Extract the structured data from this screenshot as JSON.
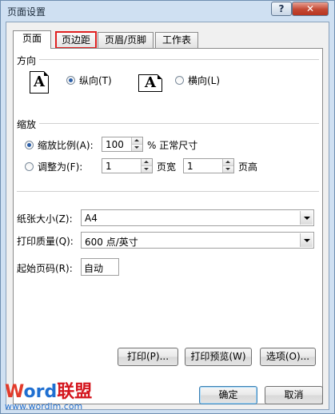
{
  "window": {
    "title": "页面设置",
    "help_label": "?",
    "close_label": "✕"
  },
  "tabs": [
    {
      "label": "页面",
      "active": true
    },
    {
      "label": "页边距",
      "active": false,
      "highlighted": true
    },
    {
      "label": "页眉/页脚",
      "active": false
    },
    {
      "label": "工作表",
      "active": false
    }
  ],
  "orientation": {
    "section_label": "方向",
    "portrait_label": "纵向(T)",
    "portrait_icon_text": "A",
    "landscape_label": "横向(L)",
    "landscape_icon_text": "A",
    "selected": "portrait"
  },
  "scaling": {
    "section_label": "缩放",
    "adjust_label": "缩放比例(A):",
    "adjust_value": "100",
    "adjust_suffix": "% 正常尺寸",
    "fit_label": "调整为(F):",
    "fit_wide_value": "1",
    "fit_wide_suffix": "页宽",
    "fit_tall_value": "1",
    "fit_tall_suffix": "页高",
    "selected": "adjust"
  },
  "paper_size": {
    "label": "纸张大小(Z):",
    "value": "A4"
  },
  "print_quality": {
    "label": "打印质量(Q):",
    "value": "600 点/英寸"
  },
  "first_page_number": {
    "label": "起始页码(R):",
    "value": "自动"
  },
  "buttons": {
    "print": "打印(P)...",
    "print_preview": "打印预览(W)",
    "options": "选项(O)...",
    "ok": "确定",
    "cancel": "取消"
  },
  "watermark": {
    "brand_w": "W",
    "brand_ord": "ord",
    "brand_cn": "联盟",
    "url": "www.wordlm.com"
  },
  "colors": {
    "tab_highlight": "#e02020",
    "radio_dot": "#2c5fa8",
    "close_button": "#c44934"
  }
}
